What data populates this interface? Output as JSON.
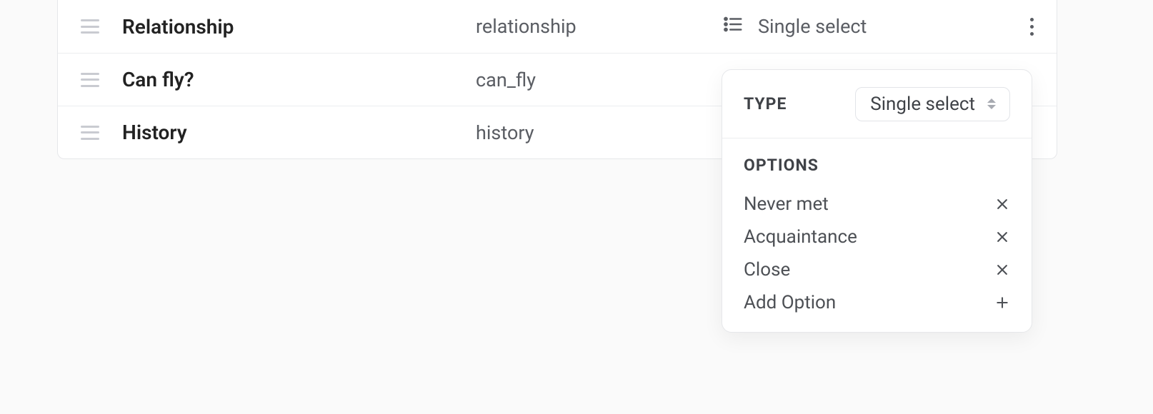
{
  "rows": [
    {
      "name": "Relationship",
      "key": "relationship",
      "type": "Single select"
    },
    {
      "name": "Can fly?",
      "key": "can_fly",
      "type": ""
    },
    {
      "name": "History",
      "key": "history",
      "type": ""
    }
  ],
  "popover": {
    "type_label": "TYPE",
    "type_value": "Single select",
    "options_label": "OPTIONS",
    "options": [
      "Never met",
      "Acquaintance",
      "Close"
    ],
    "add_option_label": "Add Option"
  }
}
